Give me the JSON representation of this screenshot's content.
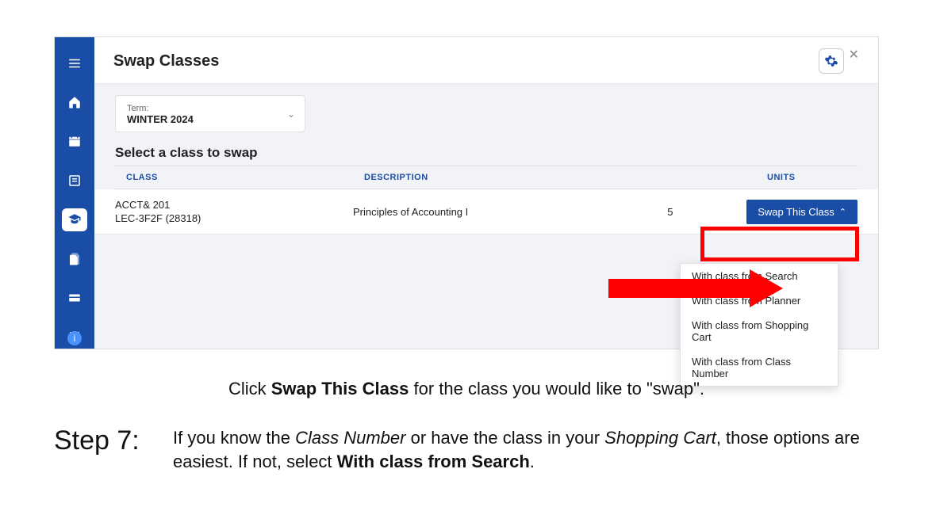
{
  "header": {
    "title": "Swap Classes"
  },
  "term": {
    "label": "Term:",
    "value": "WINTER 2024"
  },
  "section_heading": "Select a class to swap",
  "columns": {
    "class": "CLASS",
    "description": "DESCRIPTION",
    "units": "UNITS"
  },
  "row": {
    "code": "ACCT& 201",
    "lec": "LEC-3F2F (28318)",
    "description": "Principles of Accounting I",
    "units": "5",
    "button": "Swap This Class"
  },
  "dropdown": {
    "opt1": "With class from Search",
    "opt2": "With class from Planner",
    "opt3": "With class from Shopping Cart",
    "opt4": "With class from Class Number"
  },
  "caption1": {
    "pre": "Click ",
    "bold": "Swap This Class",
    "post": " for the class you would like to \"swap\"."
  },
  "step": {
    "label": "Step 7:",
    "l1_pre": "If you know the ",
    "l1_i1": "Class Number",
    "l1_mid": " or have the class in your ",
    "l1_i2": "Shopping Cart",
    "l1_post": ", those options are easiest. If not, select ",
    "l1_bold": "With class from Search",
    "l1_end": "."
  }
}
